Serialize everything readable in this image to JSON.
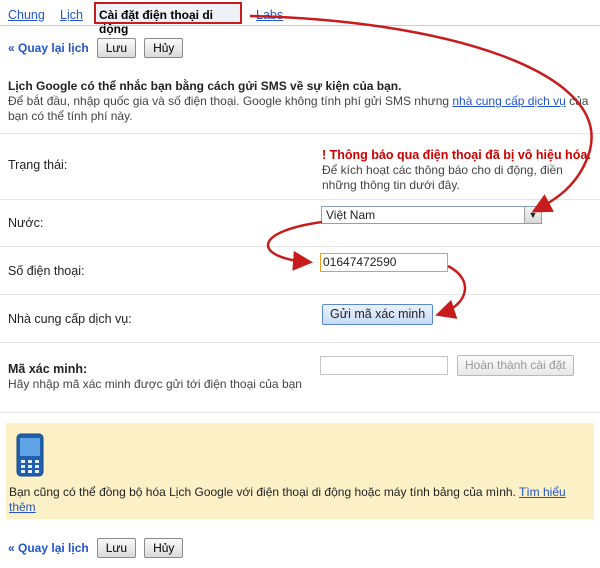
{
  "tabs": {
    "general": "Chung",
    "calendars": "Lịch",
    "mobile": "Cài đặt điện thoại di động",
    "labs": "Labs"
  },
  "top_bar": {
    "back": "« Quay lại lịch",
    "save": "Lưu",
    "cancel": "Hủy"
  },
  "intro": {
    "title": "Lịch Google có thể nhắc bạn bằng cách gửi SMS về sự kiện của bạn.",
    "text_before": "Để bắt đầu, nhập quốc gia và số điện thoại. Google không tính phí gửi SMS nhưng ",
    "link": "nhà cung cấp dịch vụ",
    "text_after": " của bạn có thể tính phí này."
  },
  "status": {
    "label": "Trạng thái:",
    "warning_icon": "exclamation-icon",
    "warning_title": "Thông báo qua điện thoại đã bị vô hiệu hóa.",
    "warning_text": "Để kích hoạt các thông báo cho di động, điền những thông tin dưới đây."
  },
  "country": {
    "label": "Nước:",
    "value": "Việt Nam"
  },
  "phone": {
    "label": "Số điện thoại:",
    "value": "01647472590"
  },
  "carrier": {
    "label": "Nhà cung cấp dịch vụ:",
    "button": "Gửi mã xác minh"
  },
  "verification": {
    "label": "Mã xác minh:",
    "hint": "Hãy nhập mã xác minh được gửi tới điện thoại của bạn",
    "value": "",
    "button": "Hoàn thành cài đặt"
  },
  "promo": {
    "icon": "mobile-phone-icon",
    "text": "Bạn cũng có thể đồng bộ hóa Lịch Google với điện thoại di động hoặc máy tính bảng của mình.",
    "link": "Tìm hiểu thêm",
    "background": "#fcf1c6"
  },
  "bottom_bar": {
    "back": "« Quay lại lịch",
    "save": "Lưu",
    "cancel": "Hủy"
  },
  "colors": {
    "annotation_red": "#c81c1c",
    "link_blue": "#2255cc",
    "warning_red": "#cc0000"
  }
}
